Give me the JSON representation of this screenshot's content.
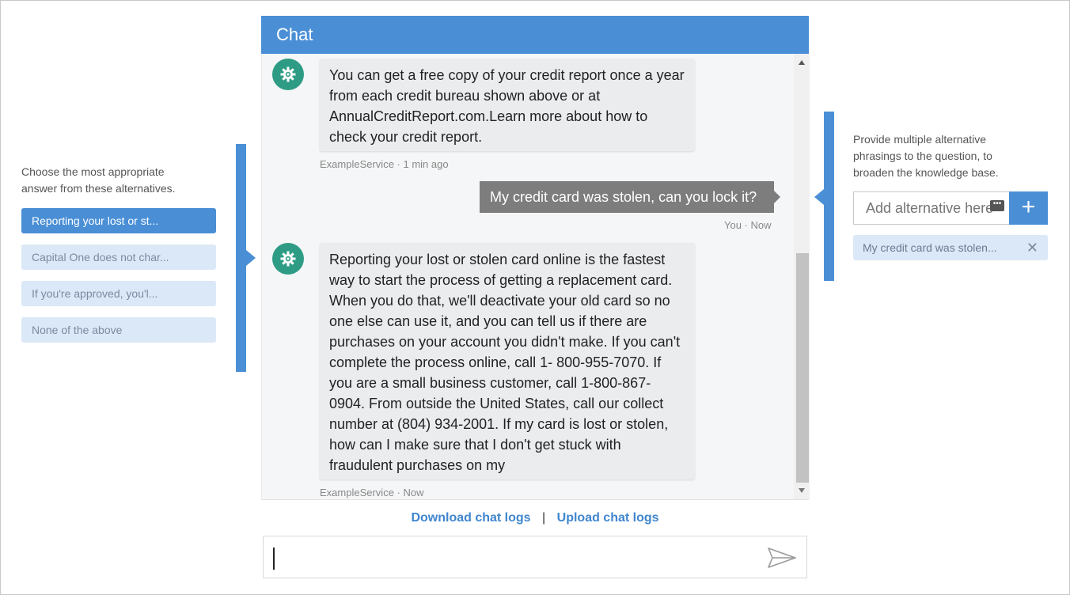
{
  "left_panel": {
    "instruction": "Choose the most appropriate answer from these alternatives.",
    "choices": [
      {
        "label": "Reporting your lost or st...",
        "selected": true
      },
      {
        "label": "Capital One does not char..."
      },
      {
        "label": "If you're approved, you'l..."
      },
      {
        "label": "None of the above"
      }
    ]
  },
  "right_panel": {
    "instruction": "Provide multiple alternative phrasings to the question, to broaden the knowledge base.",
    "input_placeholder": "Add alternative here",
    "add_button": "+",
    "chips": [
      {
        "label": "My credit card was stolen...",
        "close": "✕"
      }
    ]
  },
  "chat": {
    "title": "Chat",
    "messages": [
      {
        "from": "bot",
        "text": "You can get a free copy of your credit report once a year from each credit bureau shown above or at AnnualCreditReport.com.Learn more about how to check your credit report.",
        "meta": "ExampleService · 1 min ago"
      },
      {
        "from": "user",
        "text": "My credit card was stolen, can you lock it?",
        "meta": "You · Now"
      },
      {
        "from": "bot",
        "text": "Reporting your lost or stolen card online is the fastest way to start the process of getting a replacement card. When you do that, we'll deactivate your old card so no one else can use it, and you can tell us if there are purchases on your account you didn't make. If you can't complete the process online, call 1- 800-955-7070. If you are a small business customer, call 1-800-867-0904. From outside the United States, call our collect number at (804) 934-2001. If my card is lost or stolen, how can I make sure that I don't get stuck with fraudulent purchases on my",
        "meta": "ExampleService · Now"
      }
    ],
    "links": {
      "download": "Download chat logs",
      "separator": "|",
      "upload": "Upload chat logs"
    },
    "input_value": ""
  },
  "colors": {
    "accent": "#4a8fd6",
    "bot_avatar": "#2e9c84",
    "user_bubble": "#7d7d7d",
    "chip_bg": "#dbe8f8"
  },
  "icons": {
    "bot_avatar": "gear-icon",
    "send": "send-icon",
    "chip_close": "close-icon",
    "add": "plus-icon"
  }
}
